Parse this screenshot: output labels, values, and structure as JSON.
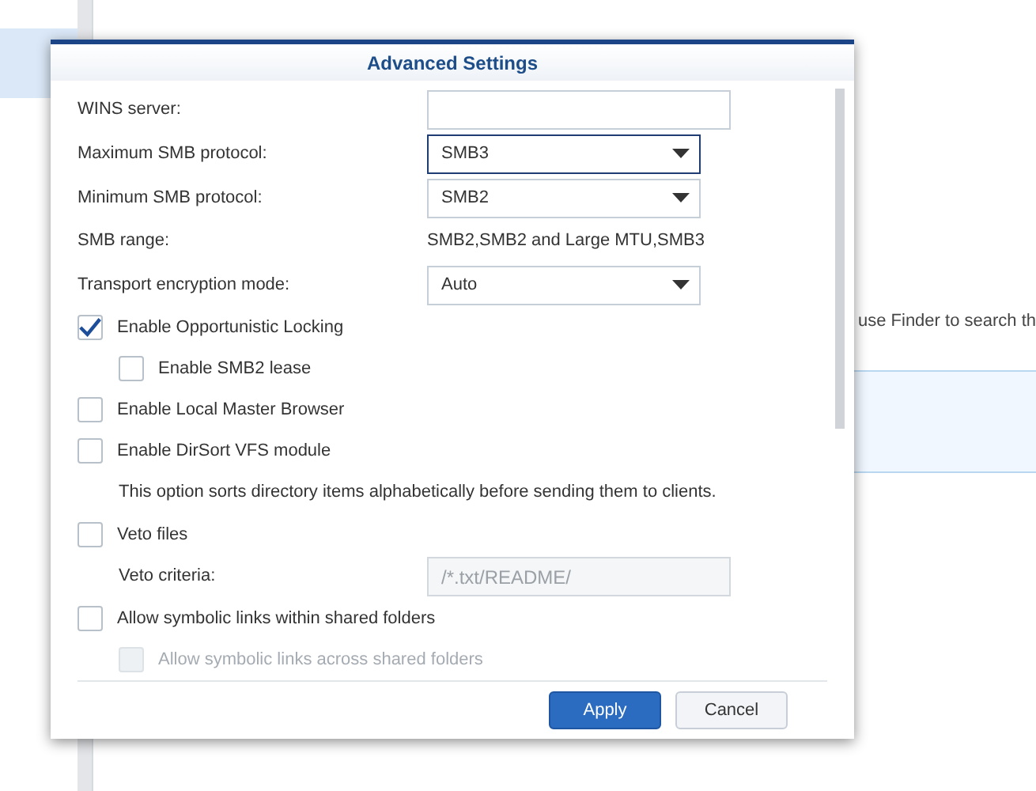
{
  "background": {
    "finder_hint": "use Finder to search th"
  },
  "dialog": {
    "title": "Advanced Settings",
    "rows": [
      {
        "kind": "field",
        "label": "WINS server:",
        "disabled": false
      },
      {
        "kind": "select",
        "label": "Maximum SMB protocol:",
        "value": "SMB3",
        "focused": true
      },
      {
        "kind": "select",
        "label": "Minimum SMB protocol:",
        "value": "SMB2",
        "focused": false
      },
      {
        "kind": "info",
        "label": "SMB range:",
        "value": "SMB2,SMB2 and Large MTU,SMB3"
      },
      {
        "kind": "select",
        "label": "Transport encryption mode:",
        "value": "Auto",
        "focused": false
      },
      {
        "kind": "checkbox",
        "label": "Enable Opportunistic Locking",
        "checked": true,
        "disabled": false,
        "children": [
          {
            "kind": "checkbox",
            "label": "Enable SMB2 lease",
            "checked": false,
            "disabled": false
          }
        ]
      },
      {
        "kind": "checkbox",
        "label": "Enable Local Master Browser",
        "checked": false,
        "disabled": false
      },
      {
        "kind": "checkbox",
        "label": "Enable DirSort VFS module",
        "checked": false,
        "disabled": false,
        "children": [
          {
            "kind": "note",
            "label": "This option sorts directory items alphabetically before sending them to clients."
          }
        ]
      },
      {
        "kind": "checkbox",
        "label": "Veto files",
        "checked": false,
        "disabled": false,
        "children": [
          {
            "kind": "field",
            "label": "Veto criteria:",
            "value": "/*.txt/README/",
            "disabled": true
          }
        ]
      },
      {
        "kind": "checkbox",
        "label": "Allow symbolic links within shared folders",
        "checked": false,
        "disabled": false,
        "children": [
          {
            "kind": "checkbox",
            "label": "Allow symbolic links across shared folders",
            "checked": false,
            "disabled": true
          }
        ]
      }
    ],
    "buttons": [
      {
        "label": "Apply",
        "kind": "primary"
      },
      {
        "label": "Cancel",
        "kind": "secondary"
      }
    ]
  }
}
